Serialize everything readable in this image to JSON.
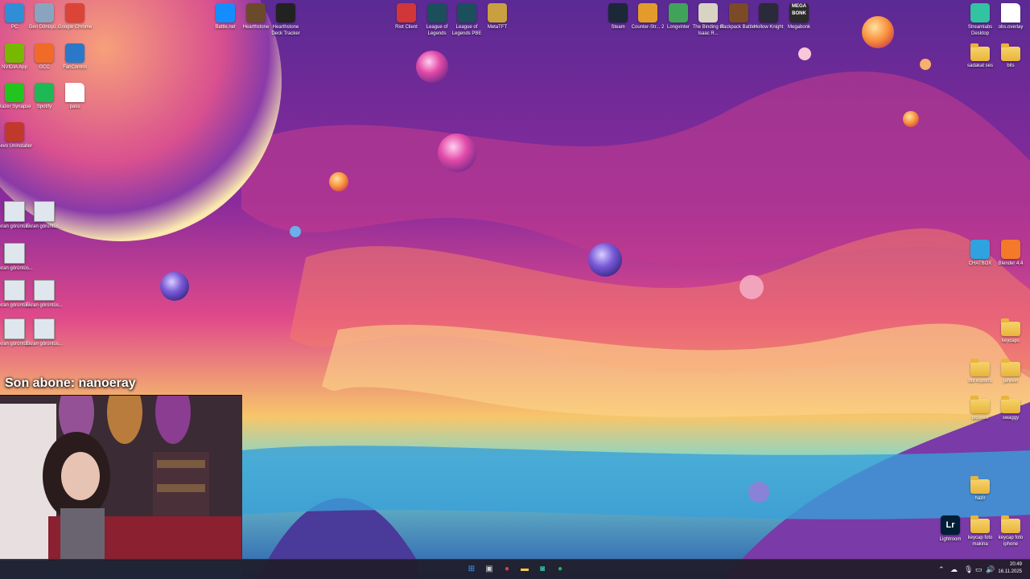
{
  "desktop": {
    "icons": [
      {
        "id": "pc",
        "label": "PC",
        "glyph": "",
        "color": "#2f8fd6",
        "kind": "app"
      },
      {
        "id": "recycle",
        "label": "Geri Dönüşü...",
        "glyph": "",
        "color": "#8aa4c0",
        "kind": "app"
      },
      {
        "id": "chrome",
        "label": "Google Chrome",
        "glyph": "",
        "color": "#db4437",
        "kind": "app"
      },
      {
        "id": "nvidia",
        "label": "NVIDIA App",
        "glyph": "",
        "color": "#76b900",
        "kind": "app"
      },
      {
        "id": "gcc",
        "label": "GCC",
        "glyph": "",
        "color": "#f06a28",
        "kind": "app"
      },
      {
        "id": "fancontrol",
        "label": "FanControl",
        "glyph": "",
        "color": "#2a79c9",
        "kind": "app"
      },
      {
        "id": "razer",
        "label": "Razer Synapse",
        "glyph": "",
        "color": "#22c41e",
        "kind": "app"
      },
      {
        "id": "spotify",
        "label": "Spotify",
        "glyph": "",
        "color": "#1db954",
        "kind": "app"
      },
      {
        "id": "pass",
        "label": "pass",
        "glyph": "",
        "color": "#ffffff",
        "kind": "file"
      },
      {
        "id": "revo",
        "label": "Revo Uninstaller",
        "glyph": "",
        "color": "#c0392b",
        "kind": "app"
      },
      {
        "id": "shot1",
        "label": "Ekran görüntüs...",
        "glyph": "",
        "color": "",
        "kind": "thumb"
      },
      {
        "id": "shot2",
        "label": "Ekran görüntüs...",
        "glyph": "",
        "color": "",
        "kind": "thumb"
      },
      {
        "id": "shot3",
        "label": "Ekran görüntüs...",
        "glyph": "",
        "color": "",
        "kind": "thumb"
      },
      {
        "id": "shot4",
        "label": "Ekran görüntüs...",
        "glyph": "",
        "color": "",
        "kind": "thumb"
      },
      {
        "id": "shot5",
        "label": "Ekran görüntüs...",
        "glyph": "",
        "color": "",
        "kind": "thumb"
      },
      {
        "id": "shot6",
        "label": "Ekran görüntüs...",
        "glyph": "",
        "color": "",
        "kind": "thumb"
      },
      {
        "id": "shot7",
        "label": "Ekran görüntüs...",
        "glyph": "",
        "color": "",
        "kind": "thumb"
      },
      {
        "id": "battlenet",
        "label": "Battle.net",
        "glyph": "",
        "color": "#148eff",
        "kind": "app"
      },
      {
        "id": "hearthstone",
        "label": "Hearthstone",
        "glyph": "",
        "color": "#6b4a2b",
        "kind": "app"
      },
      {
        "id": "hsdeck",
        "label": "Hearthstone Deck Tracker",
        "glyph": "",
        "color": "#222222",
        "kind": "app"
      },
      {
        "id": "riot",
        "label": "Riot Client",
        "glyph": "",
        "color": "#d13639",
        "kind": "app"
      },
      {
        "id": "lol",
        "label": "League of Legends",
        "glyph": "",
        "color": "#1b4f5c",
        "kind": "app"
      },
      {
        "id": "lolpbe",
        "label": "League of Legends PBE",
        "glyph": "",
        "color": "#1b4f5c",
        "kind": "app"
      },
      {
        "id": "metatft",
        "label": "MetaTFT",
        "glyph": "",
        "color": "#c8a040",
        "kind": "app"
      },
      {
        "id": "steam",
        "label": "Steam",
        "glyph": "",
        "color": "#1b2838",
        "kind": "app"
      },
      {
        "id": "cs2",
        "label": "Counter-Str... 2",
        "glyph": "",
        "color": "#e39c2a",
        "kind": "app"
      },
      {
        "id": "longvinter",
        "label": "Longvinter",
        "glyph": "",
        "color": "#3fa45a",
        "kind": "app"
      },
      {
        "id": "isaac",
        "label": "The Binding of Isaac R...",
        "glyph": "",
        "color": "#d9d3c4",
        "kind": "app"
      },
      {
        "id": "backpack",
        "label": "Backpack Battles",
        "glyph": "",
        "color": "#7a4b26",
        "kind": "app"
      },
      {
        "id": "hollow",
        "label": "Hollow Knight",
        "glyph": "",
        "color": "#2a2a3a",
        "kind": "app"
      },
      {
        "id": "megabonk",
        "label": "Megabonk",
        "glyph": "MEGA BONK",
        "color": "#2b2b2b",
        "kind": "app"
      },
      {
        "id": "streamlabs",
        "label": "Streamlabs Desktop",
        "glyph": "",
        "color": "#31c3a2",
        "kind": "app"
      },
      {
        "id": "obsoverlay",
        "label": "obs.overlay",
        "glyph": "",
        "color": "#ffffff",
        "kind": "file"
      },
      {
        "id": "sadakat",
        "label": "sadakat ses",
        "glyph": "",
        "color": "",
        "kind": "folder"
      },
      {
        "id": "bits",
        "label": "bits",
        "glyph": "",
        "color": "",
        "kind": "folder"
      },
      {
        "id": "chatgpt",
        "label": "CHATBOX",
        "glyph": "",
        "color": "#2ea3e0",
        "kind": "app"
      },
      {
        "id": "blender",
        "label": "Blender 4.4",
        "glyph": "",
        "color": "#f5792a",
        "kind": "app"
      },
      {
        "id": "keycaps",
        "label": "keycaps",
        "glyph": "",
        "color": "",
        "kind": "folder"
      },
      {
        "id": "esports",
        "label": "bbl esports",
        "glyph": "",
        "color": "",
        "kind": "folder"
      },
      {
        "id": "jahrein",
        "label": "jahrein",
        "glyph": "",
        "color": "",
        "kind": "folder"
      },
      {
        "id": "pqueen",
        "label": "pqueen",
        "glyph": "",
        "color": "",
        "kind": "folder"
      },
      {
        "id": "swaggy",
        "label": "swaggy",
        "glyph": "",
        "color": "",
        "kind": "folder"
      },
      {
        "id": "hazir",
        "label": "hazir",
        "glyph": "",
        "color": "",
        "kind": "folder"
      },
      {
        "id": "lightroom",
        "label": "Lightroom",
        "glyph": "Lr",
        "color": "#001e36",
        "kind": "app"
      },
      {
        "id": "keycapmakina",
        "label": "keycap foto makina",
        "glyph": "",
        "color": "",
        "kind": "folder"
      },
      {
        "id": "keycapiphone",
        "label": "keycap foto iphone",
        "glyph": "",
        "color": "",
        "kind": "folder"
      }
    ]
  },
  "overlay": {
    "sub_banner": "Son abone: nanoeray"
  },
  "taskbar": {
    "buttons": [
      {
        "id": "start",
        "glyph": "⊞",
        "color": "#3aa0ff"
      },
      {
        "id": "taskview",
        "glyph": "▣",
        "color": "#cfcfcf"
      },
      {
        "id": "chrome",
        "glyph": "●",
        "color": "#db4437"
      },
      {
        "id": "explorer",
        "glyph": "▬",
        "color": "#f3c94b"
      },
      {
        "id": "streamlabs",
        "glyph": "◙",
        "color": "#31c3a2"
      },
      {
        "id": "spotify",
        "glyph": "●",
        "color": "#1db954"
      }
    ],
    "tray_icons": [
      "⌃",
      "☁",
      "🎙",
      "▭",
      "🔊"
    ],
    "clock_time": "20:49",
    "clock_date": "16.11.2025"
  }
}
